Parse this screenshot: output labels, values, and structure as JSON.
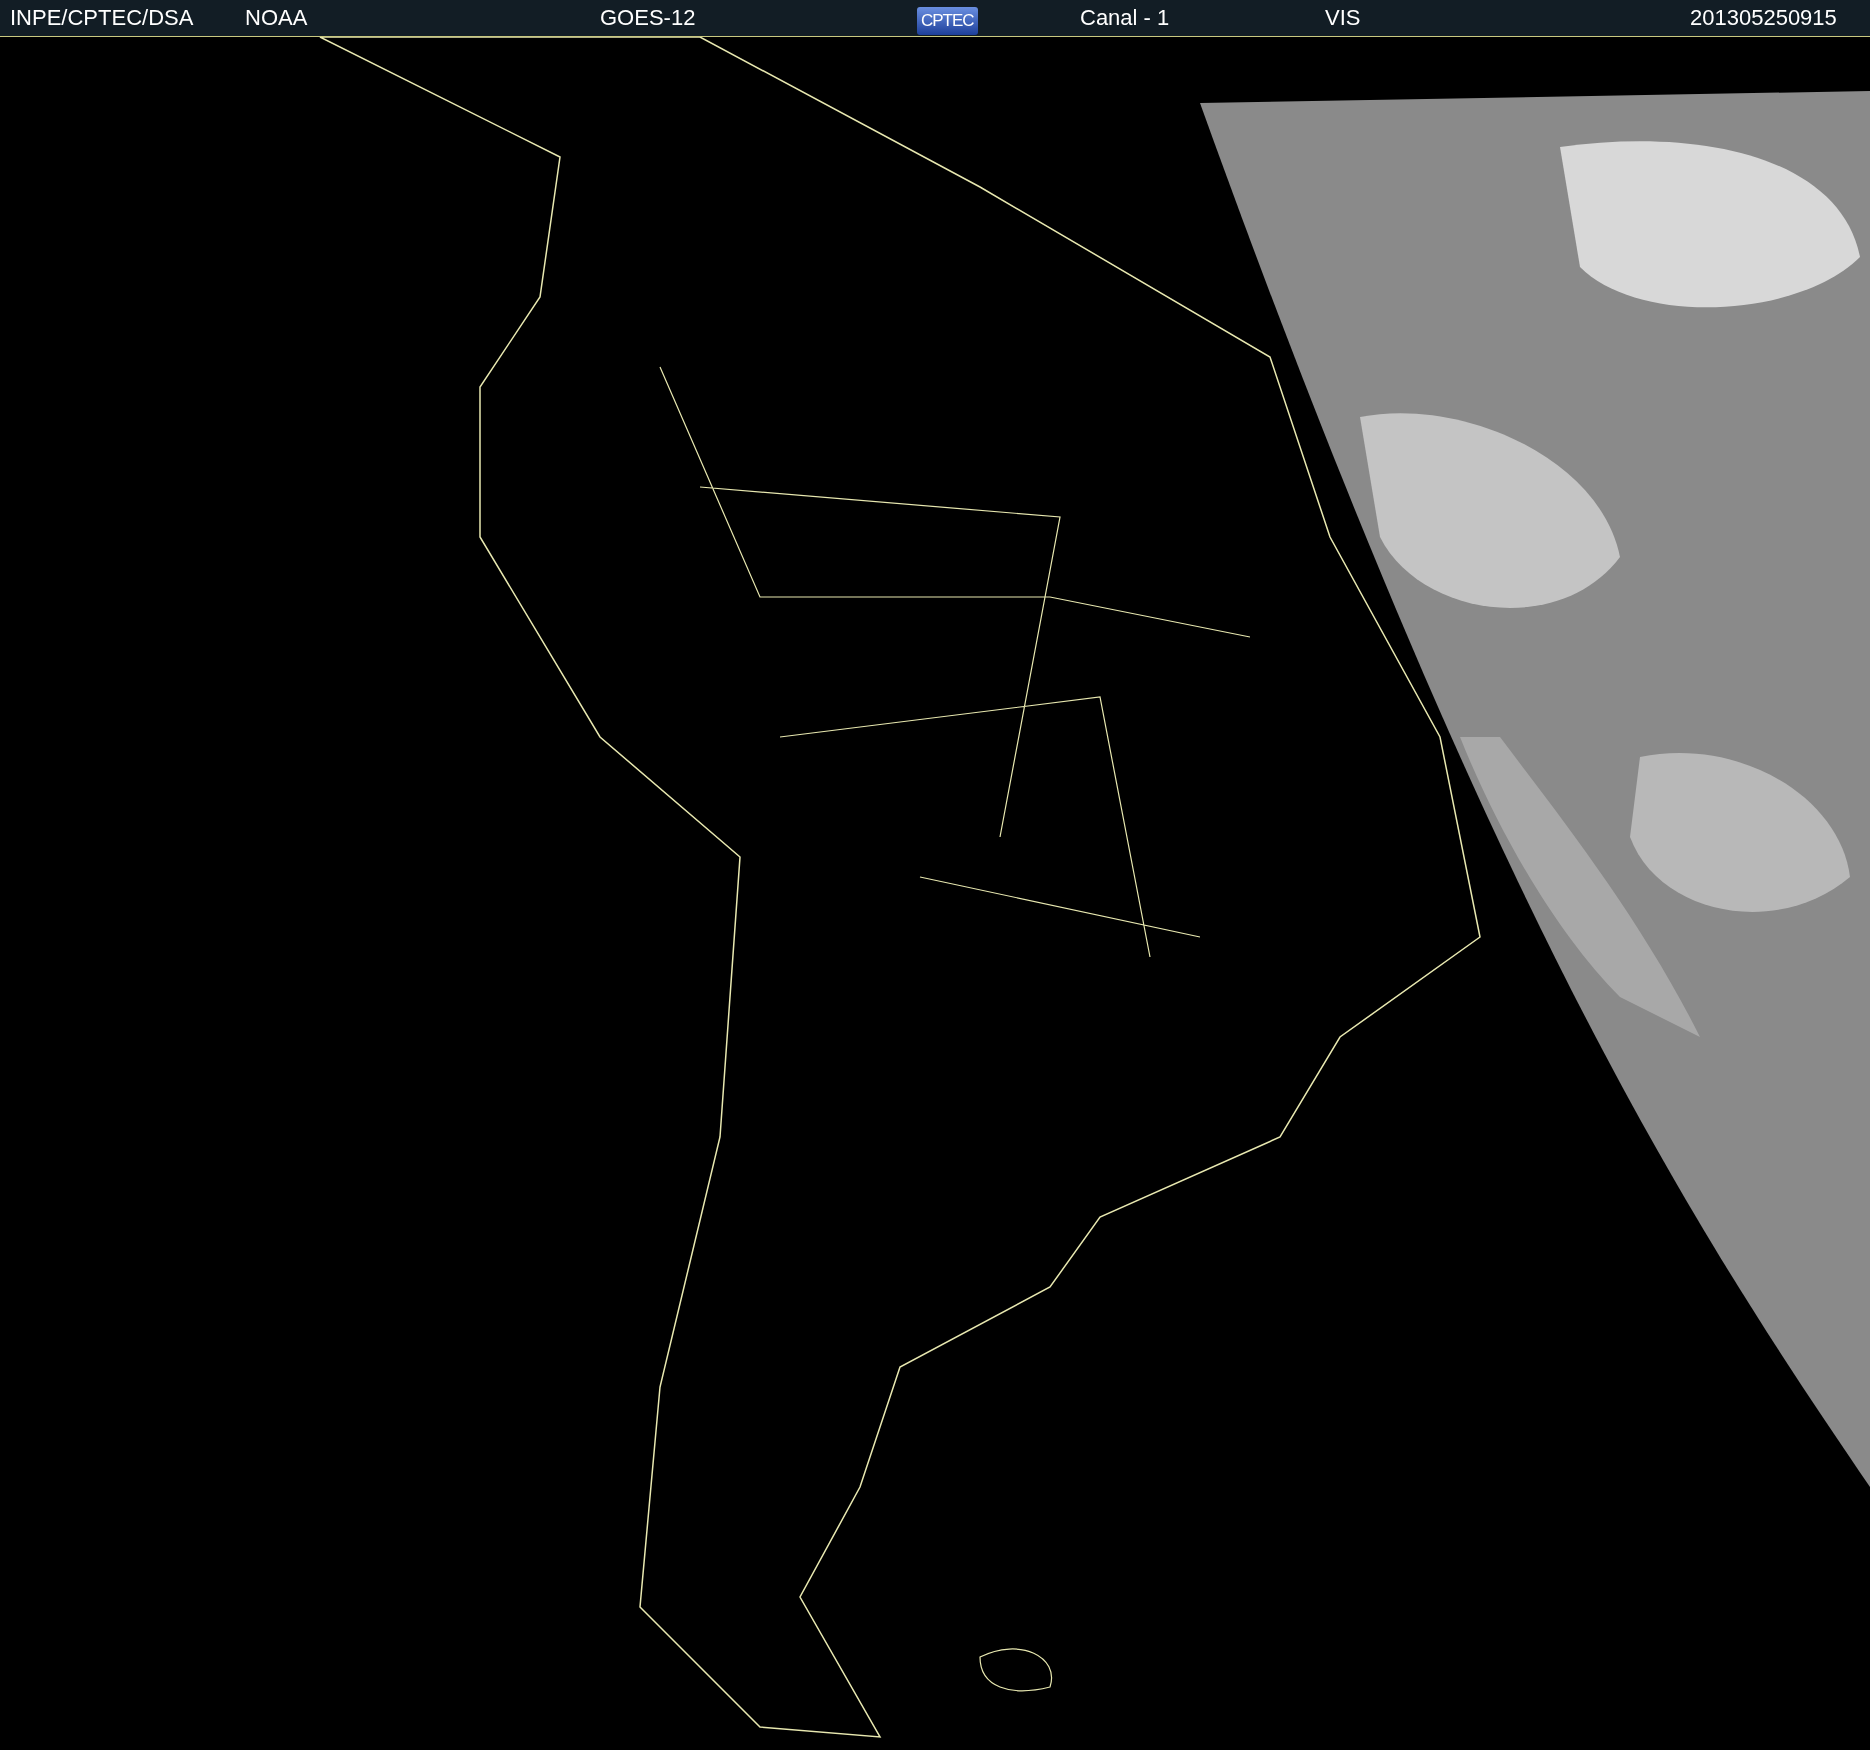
{
  "header": {
    "items": [
      {
        "kind": "text",
        "text": "INPE/CPTEC/DSA"
      },
      {
        "kind": "text",
        "text": "NOAA"
      },
      {
        "kind": "text",
        "text": "GOES-12"
      },
      {
        "kind": "logo",
        "text": "CPTEC"
      },
      {
        "kind": "text",
        "text": "Canal - 1"
      },
      {
        "kind": "text",
        "text": "VIS"
      },
      {
        "kind": "text",
        "text": "201305250915"
      }
    ]
  }
}
